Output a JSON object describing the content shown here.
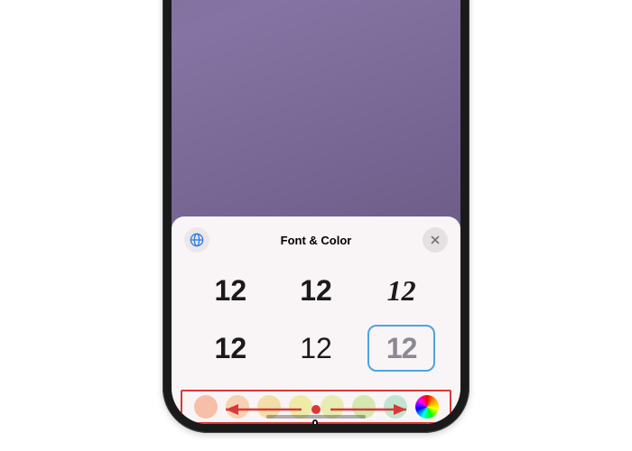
{
  "sheet": {
    "title": "Font & Color"
  },
  "fonts": {
    "options": [
      {
        "label": "12",
        "selected": false
      },
      {
        "label": "12",
        "selected": false
      },
      {
        "label": "12",
        "selected": false
      },
      {
        "label": "12",
        "selected": false
      },
      {
        "label": "12",
        "selected": false
      },
      {
        "label": "12",
        "selected": true
      }
    ]
  },
  "colors": {
    "swatches": [
      {
        "hex": "#f5c0a7"
      },
      {
        "hex": "#f7d1b3"
      },
      {
        "hex": "#f3deaa"
      },
      {
        "hex": "#f0eaa7"
      },
      {
        "hex": "#e9ecb2"
      },
      {
        "hex": "#d5e8b0"
      },
      {
        "hex": "#c1e5d0"
      },
      {
        "hex": "wheel"
      }
    ]
  },
  "icons": {
    "globe": "globe-icon",
    "close": "close-icon"
  }
}
